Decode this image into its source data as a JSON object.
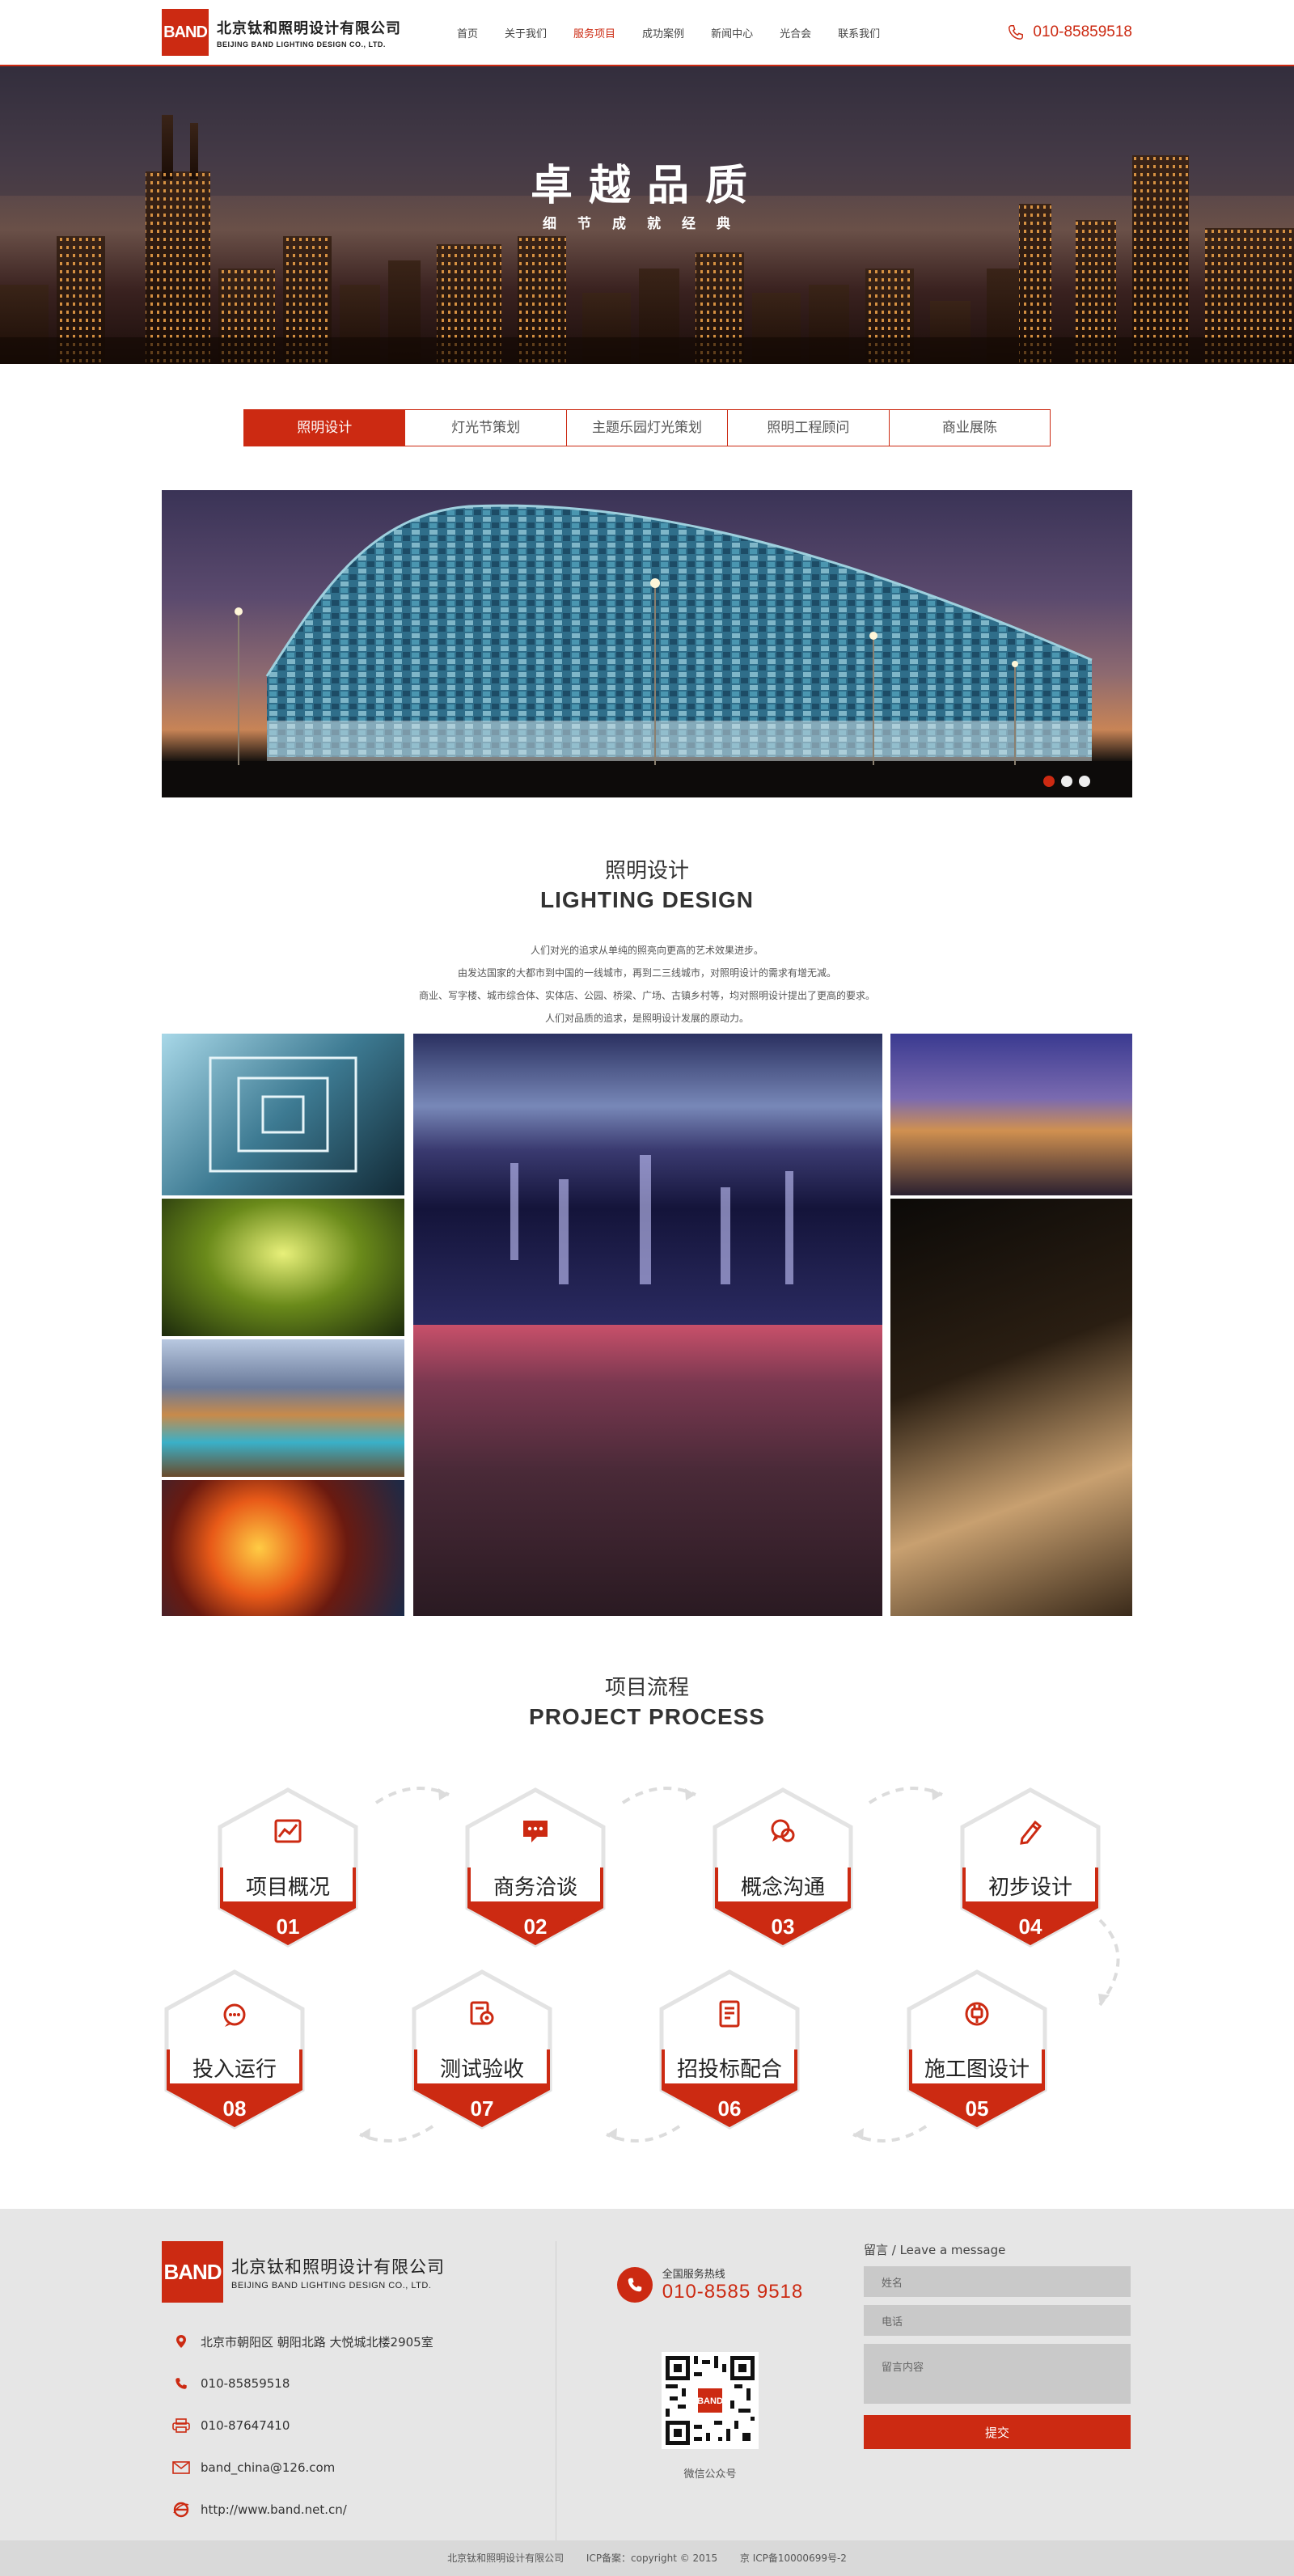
{
  "brand": {
    "logo_text": "BAND",
    "name_cn": "北京钛和照明设计有限公司",
    "name_en": "BEIJING BAND LIGHTING DESIGN CO., LTD."
  },
  "nav": {
    "items": [
      "首页",
      "关于我们",
      "服务项目",
      "成功案例",
      "新闻中心",
      "光合会",
      "联系我们"
    ],
    "active_index": 2
  },
  "hotline": "010-85859518",
  "banner": {
    "title": "卓越品质",
    "subtitle": "细节成就经典"
  },
  "tabs": {
    "items": [
      "照明设计",
      "灯光节策划",
      "主题乐园灯光策划",
      "照明工程顾问",
      "商业展陈"
    ],
    "active_index": 0
  },
  "slider": {
    "slide_count": 3,
    "active_index": 0
  },
  "lighting": {
    "title_cn": "照明设计",
    "title_en": "LIGHTING DESIGN",
    "intro": [
      "人们对光的追求从单纯的照亮向更高的艺术效果进步。",
      "由发达国家的大都市到中国的一线城市，再到二三线城市，对照明设计的需求有增无减。",
      "商业、写字楼、城市综合体、实体店、公园、桥梁、广场、古镇乡村等，均对照明设计提出了更高的要求。",
      "人们对品质的追求，是照明设计发展的原动力。"
    ]
  },
  "process": {
    "title_cn": "项目流程",
    "title_en": "PROJECT PROCESS",
    "steps": [
      {
        "label": "项目概况",
        "num": "01",
        "icon": "chart-icon"
      },
      {
        "label": "商务洽谈",
        "num": "02",
        "icon": "chat-icon"
      },
      {
        "label": "概念沟通",
        "num": "03",
        "icon": "discussion-icon"
      },
      {
        "label": "初步设计",
        "num": "04",
        "icon": "pencil-icon"
      },
      {
        "label": "施工图设计",
        "num": "05",
        "icon": "plug-icon"
      },
      {
        "label": "招投标配合",
        "num": "06",
        "icon": "document-icon"
      },
      {
        "label": "测试验收",
        "num": "07",
        "icon": "inspect-icon"
      },
      {
        "label": "投入运行",
        "num": "08",
        "icon": "power-icon"
      }
    ]
  },
  "footer": {
    "address": "北京市朝阳区 朝阳北路 大悦城北楼2905室",
    "phone": "010-85859518",
    "fax": "010-87647410",
    "email": "band_china@126.com",
    "website": "http://www.band.net.cn/",
    "hot_label": "全国服务热线",
    "hot_number": "010-8585 9518",
    "qr_caption": "微信公众号",
    "qr_logo": "BAND",
    "message_title": "留言 / Leave a message",
    "name_placeholder": "姓名",
    "phone_placeholder": "电话",
    "content_placeholder": "留言内容",
    "submit_label": "提交"
  },
  "copyright": {
    "company": "北京钛和照明设计有限公司",
    "record": "ICP备案：copyright © 2015",
    "icp": "京 ICP备10000699号-2"
  },
  "colors": {
    "accent": "#cc2a12",
    "footer_bg": "#e6e6e6"
  }
}
